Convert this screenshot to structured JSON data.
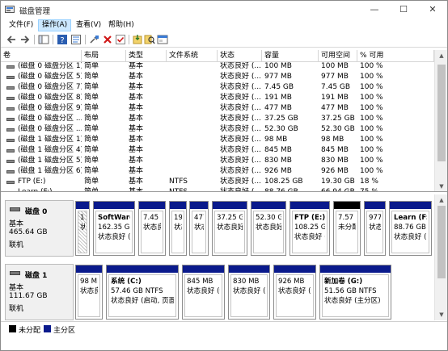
{
  "window": {
    "title": "磁盘管理",
    "icon": "disk-management-icon",
    "controls": [
      "minimize-icon",
      "maximize-icon",
      "close-icon"
    ]
  },
  "menu": [
    "文件(F)",
    "操作(A)",
    "查看(V)",
    "帮助(H)"
  ],
  "toolbar_icons": [
    "back-arrow-icon",
    "forward-arrow-icon",
    "console-tree-icon",
    "help-icon",
    "properties-icon",
    "connect-disk-icon",
    "delete-icon",
    "check-icon",
    "import-icon",
    "search-icon",
    "console-icon"
  ],
  "list": {
    "columns": [
      "卷",
      "布局",
      "类型",
      "文件系统",
      "状态",
      "容量",
      "可用空间",
      "% 可用"
    ],
    "rows": [
      [
        "(磁盘 0 磁盘分区 1)",
        "简单",
        "基本",
        "",
        "状态良好 (...",
        "100 MB",
        "100 MB",
        "100 %"
      ],
      [
        "(磁盘 0 磁盘分区 5)",
        "简单",
        "基本",
        "",
        "状态良好 (...",
        "977 MB",
        "977 MB",
        "100 %"
      ],
      [
        "(磁盘 0 磁盘分区 7)",
        "简单",
        "基本",
        "",
        "状态良好 (...",
        "7.45 GB",
        "7.45 GB",
        "100 %"
      ],
      [
        "(磁盘 0 磁盘分区 8)",
        "简单",
        "基本",
        "",
        "状态良好 (...",
        "191 MB",
        "191 MB",
        "100 %"
      ],
      [
        "(磁盘 0 磁盘分区 9)",
        "简单",
        "基本",
        "",
        "状态良好 (...",
        "477 MB",
        "477 MB",
        "100 %"
      ],
      [
        "(磁盘 0 磁盘分区 ...",
        "简单",
        "基本",
        "",
        "状态良好 (...",
        "37.25 GB",
        "37.25 GB",
        "100 %"
      ],
      [
        "(磁盘 0 磁盘分区 ...",
        "简单",
        "基本",
        "",
        "状态良好 (...",
        "52.30 GB",
        "52.30 GB",
        "100 %"
      ],
      [
        "(磁盘 1 磁盘分区 1)",
        "简单",
        "基本",
        "",
        "状态良好 (...",
        "98 MB",
        "98 MB",
        "100 %"
      ],
      [
        "(磁盘 1 磁盘分区 4)",
        "简单",
        "基本",
        "",
        "状态良好 (...",
        "845 MB",
        "845 MB",
        "100 %"
      ],
      [
        "(磁盘 1 磁盘分区 5)",
        "简单",
        "基本",
        "",
        "状态良好 (...",
        "830 MB",
        "830 MB",
        "100 %"
      ],
      [
        "(磁盘 1 磁盘分区 6)",
        "简单",
        "基本",
        "",
        "状态良好 (...",
        "926 MB",
        "926 MB",
        "100 %"
      ],
      [
        "FTP (E:)",
        "简单",
        "基本",
        "NTFS",
        "状态良好 (...",
        "108.25 GB",
        "19.30 GB",
        "18 %"
      ],
      [
        "Learn (F:)",
        "简单",
        "基本",
        "NTFS",
        "状态良好 (...",
        "88.76 GB",
        "66.94 GB",
        "75 %"
      ]
    ]
  },
  "disks": [
    {
      "name": "磁盘 0",
      "type": "基本",
      "size": "465.64 GB",
      "status": "联机",
      "partitions": [
        {
          "lines": [
            "10",
            "状"
          ],
          "bold": false,
          "hatched": true
        },
        {
          "lines": [
            "SoftWare",
            "162.35 GB",
            "状态良好 ("
          ],
          "bold": true,
          "hatched": false
        },
        {
          "lines": [
            "",
            "7.45 GB",
            "状态良好"
          ],
          "bold": false,
          "hatched": false
        },
        {
          "lines": [
            "",
            "191",
            "状态"
          ],
          "bold": false,
          "hatched": false
        },
        {
          "lines": [
            "",
            "477",
            "状态"
          ],
          "bold": false,
          "hatched": false
        },
        {
          "lines": [
            "",
            "37.25 GB",
            "状态良好"
          ],
          "bold": false,
          "hatched": false
        },
        {
          "lines": [
            "",
            "52.30 GB",
            "状态良好"
          ],
          "bold": false,
          "hatched": false
        },
        {
          "lines": [
            "FTP  (E:)",
            "108.25 GB",
            "状态良好 ("
          ],
          "bold": true,
          "hatched": false
        },
        {
          "lines": [
            "",
            "7.57 GI",
            "未分配"
          ],
          "bold": false,
          "hatched": false,
          "unalloc": true
        },
        {
          "lines": [
            "",
            "977 I",
            "状态"
          ],
          "bold": false,
          "hatched": false
        },
        {
          "lines": [
            "Learn  (F:)",
            "88.76 GB N",
            "状态良好 ("
          ],
          "bold": true,
          "hatched": false
        }
      ]
    },
    {
      "name": "磁盘 1",
      "type": "基本",
      "size": "111.67 GB",
      "status": "联机",
      "partitions": [
        {
          "lines": [
            "",
            "98 MB",
            "状态良好"
          ],
          "bold": false,
          "hatched": false
        },
        {
          "lines": [
            "系统  (C:)",
            "57.46 GB NTFS",
            "状态良好 (启动, 页面"
          ],
          "bold": true,
          "hatched": false
        },
        {
          "lines": [
            "",
            "845 MB",
            "状态良好 (物"
          ],
          "bold": false,
          "hatched": false
        },
        {
          "lines": [
            "",
            "830 MB",
            "状态良好 (饮"
          ],
          "bold": false,
          "hatched": false
        },
        {
          "lines": [
            "",
            "926 MB",
            "状态良好 (饮"
          ],
          "bold": false,
          "hatched": false
        },
        {
          "lines": [
            "新加卷  (G:)",
            "51.56 GB NTFS",
            "状态良好 (主分区)"
          ],
          "bold": true,
          "hatched": false
        }
      ]
    }
  ],
  "legend": [
    {
      "label": "未分配",
      "color": "#000000"
    },
    {
      "label": "主分区",
      "color": "#0a1a8c"
    }
  ]
}
